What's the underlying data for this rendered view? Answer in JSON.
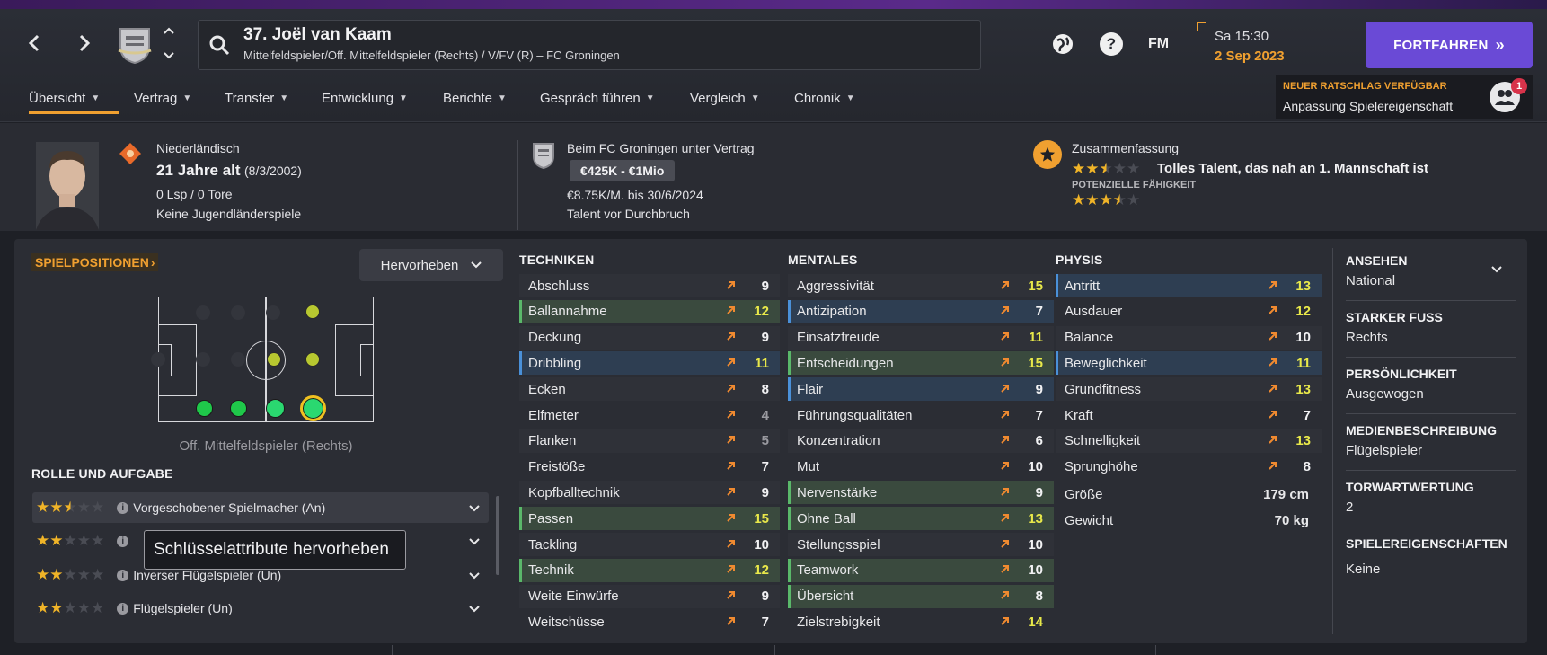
{
  "header": {
    "player_title": "37. Joël van Kaam",
    "player_subtitle": "Mittelfeldspieler/Off. Mittelfeldspieler (Rechts) / V/FV (R) – FC Groningen",
    "date_line1": "Sa 15:30",
    "date_line2": "2 Sep 2023",
    "fm_label": "FM",
    "help_label": "?",
    "continue_label": "FORTFAHREN",
    "continue_icon": "»",
    "back_icon": "‹",
    "forward_icon": "›",
    "up_icon": "⌃",
    "down_icon": "⌄"
  },
  "tabs": [
    {
      "label": "Übersicht"
    },
    {
      "label": "Vertrag"
    },
    {
      "label": "Transfer"
    },
    {
      "label": "Entwicklung"
    },
    {
      "label": "Berichte"
    },
    {
      "label": "Gespräch führen"
    },
    {
      "label": "Vergleich"
    },
    {
      "label": "Chronik"
    }
  ],
  "advice": {
    "title": "NEUER RATSCHLAG VERFÜGBAR",
    "text": "Anpassung Spielereigenschaft",
    "badge": "1"
  },
  "info": {
    "nationality": "Niederländisch",
    "age": "21 Jahre alt",
    "birthdate": "(8/3/2002)",
    "caps": "0 Lsp / 0 Tore",
    "youth": "Keine Jugendländerspiele",
    "contract_title": "Beim FC Groningen unter Vertrag",
    "value": "€425K - €1Mio",
    "wage": "€8.75K/M. bis 30/6/2024",
    "status": "Talent vor Durchbruch",
    "summary_title": "Zusammenfassung",
    "summary_text": "Tolles Talent, das nah an 1. Mannschaft ist",
    "potential_label": "POTENZIELLE FÄHIGKEIT",
    "current_stars": 2.5,
    "potential_stars": 3.5
  },
  "positions": {
    "title": "SPIELPOSITIONEN",
    "title_icon": "›",
    "highlight_button": "Hervorheben",
    "caption": "Off. Mittelfeldspieler (Rechts)"
  },
  "roles": {
    "title": "ROLLE UND AUFGABE",
    "items": [
      {
        "label": "Vorgeschobener Spielmacher (An)",
        "stars": 2.5
      },
      {
        "label": "",
        "stars": 2
      },
      {
        "label": "Inverser Flügelspieler (Un)",
        "stars": 2
      },
      {
        "label": "Flügelspieler (Un)",
        "stars": 2
      }
    ],
    "tooltip": "Schlüsselattribute hervorheben"
  },
  "techniken": {
    "title": "TECHNIKEN",
    "rows": [
      {
        "name": "Abschluss",
        "value": 9,
        "hl": ""
      },
      {
        "name": "Ballannahme",
        "value": 12,
        "hl": "green"
      },
      {
        "name": "Deckung",
        "value": 9,
        "hl": ""
      },
      {
        "name": "Dribbling",
        "value": 11,
        "hl": "blue"
      },
      {
        "name": "Ecken",
        "value": 8,
        "hl": ""
      },
      {
        "name": "Elfmeter",
        "value": 4,
        "hl": ""
      },
      {
        "name": "Flanken",
        "value": 5,
        "hl": ""
      },
      {
        "name": "Freistöße",
        "value": 7,
        "hl": ""
      },
      {
        "name": "Kopfballtechnik",
        "value": 9,
        "hl": ""
      },
      {
        "name": "Passen",
        "value": 15,
        "hl": "green"
      },
      {
        "name": "Tackling",
        "value": 10,
        "hl": ""
      },
      {
        "name": "Technik",
        "value": 12,
        "hl": "green"
      },
      {
        "name": "Weite Einwürfe",
        "value": 9,
        "hl": ""
      },
      {
        "name": "Weitschüsse",
        "value": 7,
        "hl": ""
      }
    ]
  },
  "mentales": {
    "title": "MENTALES",
    "rows": [
      {
        "name": "Aggressivität",
        "value": 15,
        "hl": ""
      },
      {
        "name": "Antizipation",
        "value": 7,
        "hl": "blue"
      },
      {
        "name": "Einsatzfreude",
        "value": 11,
        "hl": ""
      },
      {
        "name": "Entscheidungen",
        "value": 15,
        "hl": "green"
      },
      {
        "name": "Flair",
        "value": 9,
        "hl": "blue"
      },
      {
        "name": "Führungsqualitäten",
        "value": 7,
        "hl": ""
      },
      {
        "name": "Konzentration",
        "value": 6,
        "hl": ""
      },
      {
        "name": "Mut",
        "value": 10,
        "hl": ""
      },
      {
        "name": "Nervenstärke",
        "value": 9,
        "hl": "green"
      },
      {
        "name": "Ohne Ball",
        "value": 13,
        "hl": "green"
      },
      {
        "name": "Stellungsspiel",
        "value": 10,
        "hl": ""
      },
      {
        "name": "Teamwork",
        "value": 10,
        "hl": "green"
      },
      {
        "name": "Übersicht",
        "value": 8,
        "hl": "green"
      },
      {
        "name": "Zielstrebigkeit",
        "value": 14,
        "hl": ""
      }
    ]
  },
  "physis": {
    "title": "PHYSIS",
    "rows": [
      {
        "name": "Antritt",
        "value": 13,
        "hl": "blue"
      },
      {
        "name": "Ausdauer",
        "value": 12,
        "hl": ""
      },
      {
        "name": "Balance",
        "value": 10,
        "hl": ""
      },
      {
        "name": "Beweglichkeit",
        "value": 11,
        "hl": "blue"
      },
      {
        "name": "Grundfitness",
        "value": 13,
        "hl": ""
      },
      {
        "name": "Kraft",
        "value": 7,
        "hl": ""
      },
      {
        "name": "Schnelligkeit",
        "value": 13,
        "hl": ""
      },
      {
        "name": "Sprunghöhe",
        "value": 8,
        "hl": ""
      }
    ],
    "height_label": "Größe",
    "height_value": "179 cm",
    "weight_label": "Gewicht",
    "weight_value": "70 kg"
  },
  "side": {
    "items": [
      {
        "title": "ANSEHEN",
        "value": "National"
      },
      {
        "title": "STARKER FUSS",
        "value": "Rechts"
      },
      {
        "title": "PERSÖNLICHKEIT",
        "value": "Ausgewogen"
      },
      {
        "title": "MEDIENBESCHREIBUNG",
        "value": "Flügelspieler"
      },
      {
        "title": "TORWARTWERTUNG",
        "value": "2"
      },
      {
        "title": "SPIELEREIGENSCHAFTEN",
        "value": "Keine"
      }
    ]
  },
  "colors": {
    "accent": "#f0a030",
    "continue": "#6a4ad6",
    "position_good": "#1fcf5a",
    "position_ok": "#b8c830"
  }
}
